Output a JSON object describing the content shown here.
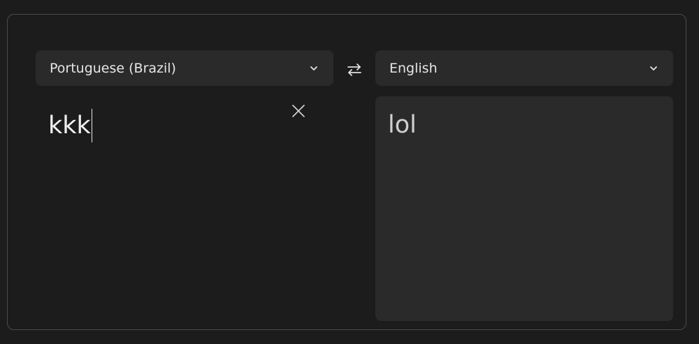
{
  "source": {
    "language": "Portuguese (Brazil)",
    "text": "kkk"
  },
  "target": {
    "language": "English",
    "text": "lol"
  },
  "icons": {
    "source_dropdown": "chevron-down-icon",
    "target_dropdown": "chevron-down-icon",
    "swap": "swap-arrows-icon",
    "clear": "close-icon"
  },
  "colors": {
    "background": "#1c1c1c",
    "panel_border": "#4a4a4a",
    "field_background": "#2a2a2a",
    "text_primary": "#f0f0f0",
    "text_secondary": "#cfcfcf"
  }
}
